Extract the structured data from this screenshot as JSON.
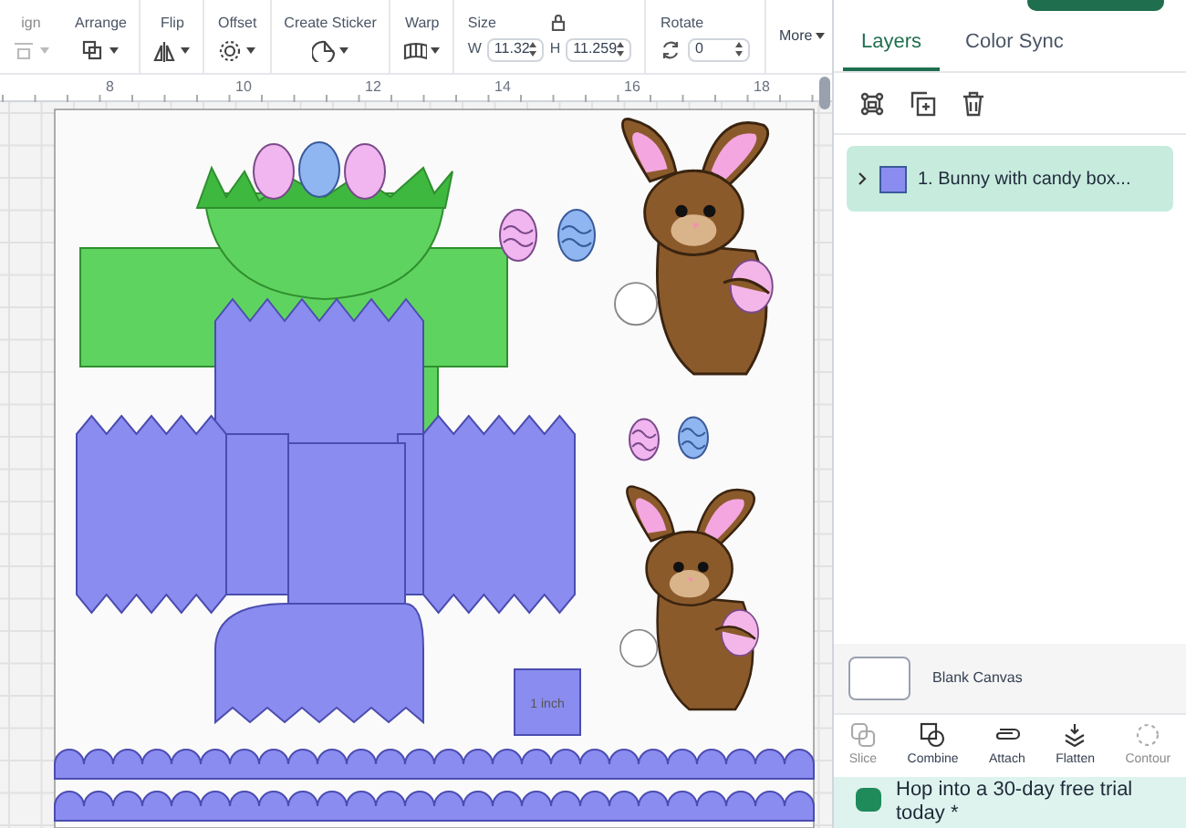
{
  "toolbar": {
    "tools": [
      {
        "kind": "align",
        "label": "ign",
        "disabled": true
      },
      {
        "kind": "arrange",
        "label": "Arrange",
        "disabled": false
      },
      {
        "kind": "flip",
        "label": "Flip",
        "disabled": false
      },
      {
        "kind": "offset",
        "label": "Offset",
        "disabled": false
      },
      {
        "kind": "sticker",
        "label": "Create Sticker",
        "disabled": false
      },
      {
        "kind": "warp",
        "label": "Warp",
        "disabled": false
      }
    ],
    "size": {
      "label": "Size",
      "w_label": "W",
      "w_value": "11.32",
      "h_label": "H",
      "h_value": "11.259"
    },
    "rotate": {
      "label": "Rotate",
      "value": "0"
    },
    "more": "More"
  },
  "ruler": {
    "marks": [
      "8",
      "10",
      "12",
      "14",
      "16",
      "18"
    ]
  },
  "canvas": {
    "scale_label": "1 inch"
  },
  "panel": {
    "tabs": [
      {
        "label": "Layers",
        "selected": true
      },
      {
        "label": "Color Sync",
        "selected": false
      }
    ],
    "layers": [
      {
        "label": "1. Bunny with candy box...",
        "selected": true,
        "expanded": false
      }
    ],
    "blank_canvas": "Blank Canvas",
    "actions": [
      {
        "kind": "slice",
        "label": "Slice",
        "disabled": true
      },
      {
        "kind": "combine",
        "label": "Combine",
        "disabled": false
      },
      {
        "kind": "attach",
        "label": "Attach",
        "disabled": false
      },
      {
        "kind": "flatten",
        "label": "Flatten",
        "disabled": false
      },
      {
        "kind": "contour",
        "label": "Contour",
        "disabled": true
      }
    ],
    "banner": "Hop into a 30-day free trial today *"
  }
}
